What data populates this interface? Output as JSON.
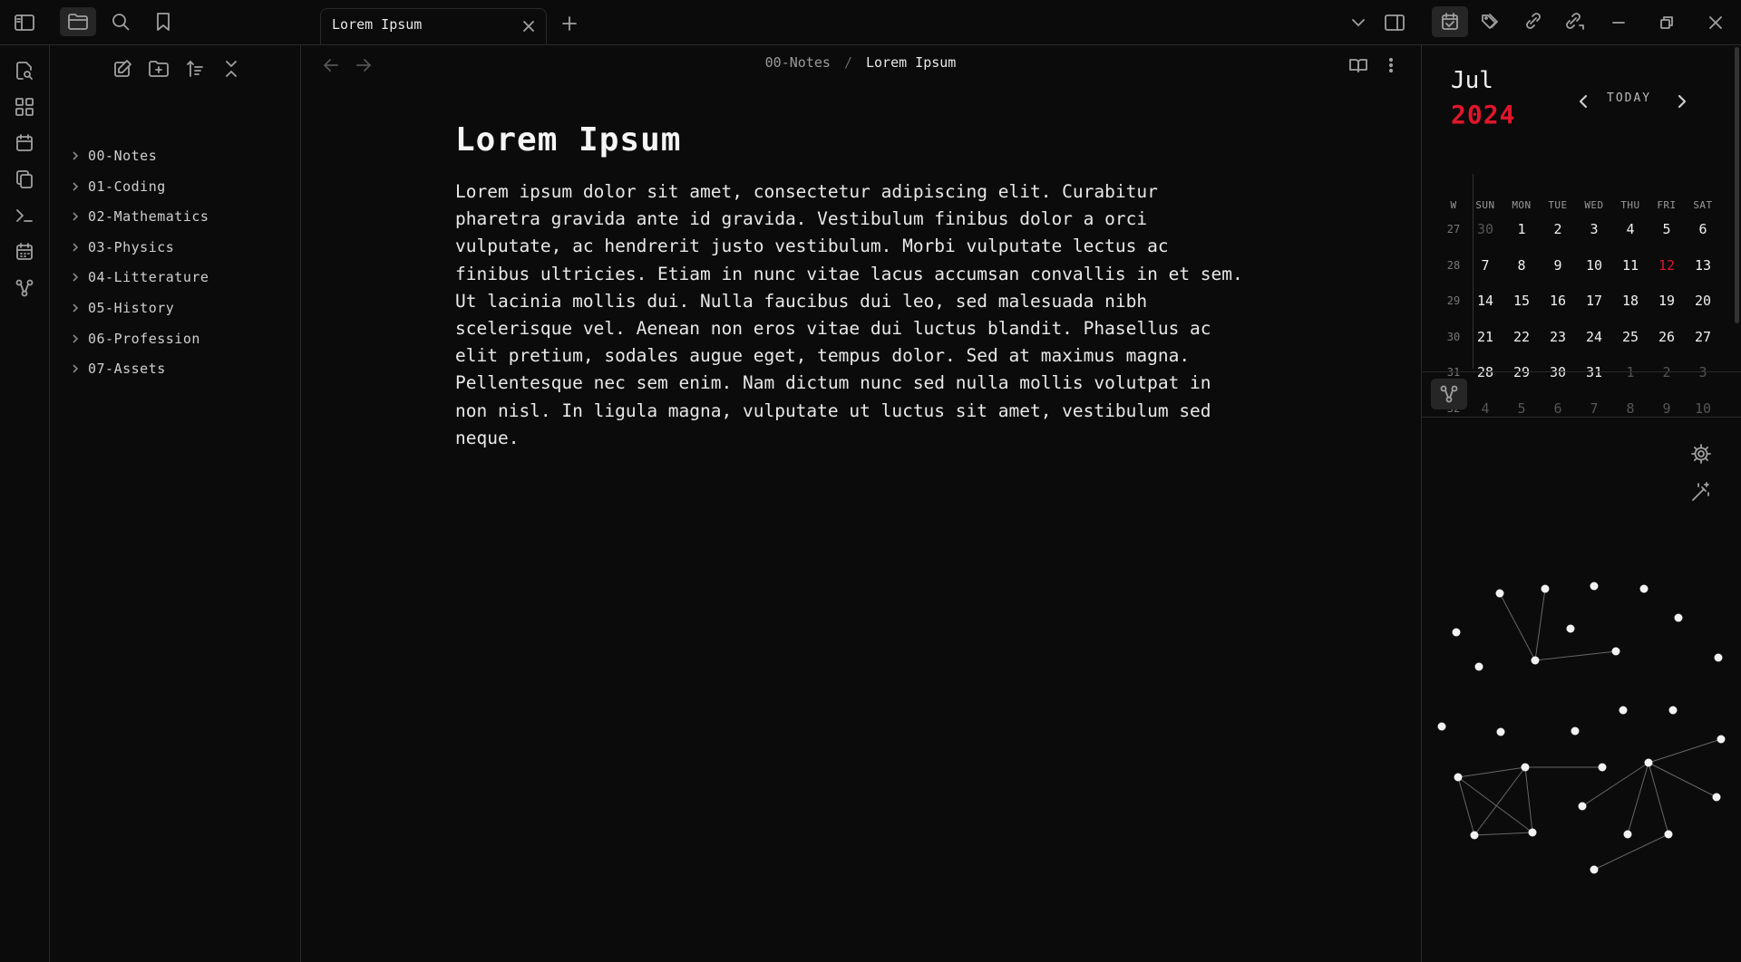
{
  "tab": {
    "title": "Lorem Ipsum"
  },
  "breadcrumb": {
    "parent": "00-Notes",
    "separator": "/",
    "current": "Lorem Ipsum"
  },
  "folders": [
    "00-Notes",
    "01-Coding",
    "02-Mathematics",
    "03-Physics",
    "04-Litterature",
    "05-History",
    "06-Profession",
    "07-Assets"
  ],
  "document": {
    "title": "Lorem Ipsum",
    "body": "Lorem ipsum dolor sit amet, consectetur adipiscing elit. Curabitur pharetra gravida ante id gravida. Vestibulum finibus dolor a orci vulputate, ac hendrerit justo vestibulum. Morbi vulputate lectus ac finibus ultricies. Etiam in nunc vitae lacus accumsan convallis in et sem. Ut lacinia mollis dui. Nulla faucibus dui leo, sed malesuada nibh scelerisque vel. Aenean non eros vitae dui luctus blandit. Phasellus ac elit pretium, sodales augue eget, tempus dolor. Sed at maximus magna. Pellentesque nec sem enim. Nam dictum nunc sed nulla mollis volutpat in non nisl. In ligula magna, vulputate ut luctus sit amet, vestibulum sed neque."
  },
  "calendar": {
    "month": "Jul",
    "year": "2024",
    "today_label": "TODAY",
    "week_header": "W",
    "day_headers": [
      "SUN",
      "MON",
      "TUE",
      "WED",
      "THU",
      "FRI",
      "SAT"
    ],
    "weeks": [
      {
        "wk": "27",
        "days": [
          "30",
          "1",
          "2",
          "3",
          "4",
          "5",
          "6"
        ]
      },
      {
        "wk": "28",
        "days": [
          "7",
          "8",
          "9",
          "10",
          "11",
          "12",
          "13"
        ]
      },
      {
        "wk": "29",
        "days": [
          "14",
          "15",
          "16",
          "17",
          "18",
          "19",
          "20"
        ]
      },
      {
        "wk": "30",
        "days": [
          "21",
          "22",
          "23",
          "24",
          "25",
          "26",
          "27"
        ]
      },
      {
        "wk": "31",
        "days": [
          "28",
          "29",
          "30",
          "31",
          "1",
          "2",
          "3"
        ]
      },
      {
        "wk": "32",
        "days": [
          "4",
          "5",
          "6",
          "7",
          "8",
          "9",
          "10"
        ]
      }
    ],
    "today": "12",
    "accent_color": "#e0162b"
  },
  "icons": {
    "left_ribbon": [
      "search-file-icon",
      "grid-icon",
      "calendar-icon",
      "copy-icon",
      "terminal-icon",
      "calendar-grid-icon",
      "graph-icon"
    ],
    "sidebar_tabs": [
      "folder-icon",
      "search-icon",
      "bookmark-icon"
    ],
    "explorer_actions": [
      "new-note-icon",
      "new-folder-icon",
      "sort-icon",
      "collapse-icon"
    ],
    "right_tabs": [
      "calendar-check-icon",
      "tags-icon",
      "backlinks-icon",
      "outgoing-links-icon"
    ],
    "window_controls": [
      "minimize-icon",
      "restore-icon",
      "close-icon"
    ]
  }
}
